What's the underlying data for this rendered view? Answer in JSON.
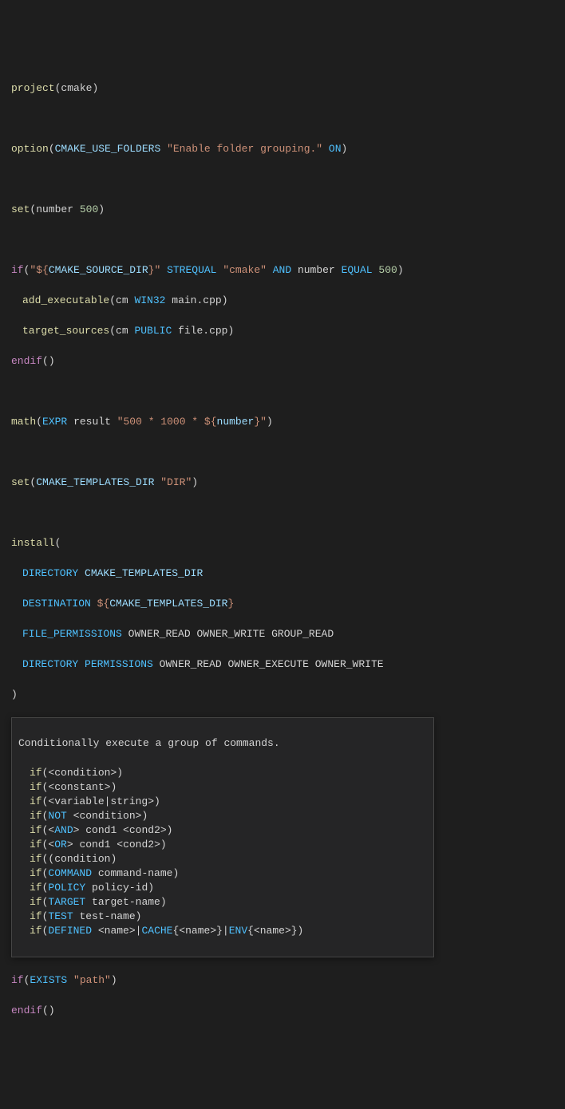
{
  "code": {
    "l1": {
      "fn": "project",
      "arg": "cmake"
    },
    "l2": {
      "fn": "option",
      "var": "CMAKE_USE_FOLDERS",
      "str": "\"Enable folder grouping.\"",
      "on": "ON"
    },
    "l3": {
      "fn": "set",
      "var": "number",
      "num": "500"
    },
    "l4": {
      "fn": "if",
      "str1": "\"${",
      "var1": "CMAKE_SOURCE_DIR",
      "str1b": "}\"",
      "op1": "STREQUAL",
      "str2": "\"cmake\"",
      "op2": "AND",
      "var2": "number",
      "op3": "EQUAL",
      "num": "500"
    },
    "l5": {
      "fn": "add_executable",
      "a1": "cm",
      "a2": "WIN32",
      "a3": "main.cpp"
    },
    "l6": {
      "fn": "target_sources",
      "a1": "cm",
      "a2": "PUBLIC",
      "a3": "file.cpp"
    },
    "l7": {
      "fn": "endif"
    },
    "l8": {
      "fn": "math",
      "a1": "EXPR",
      "a2": "result",
      "s1": "\"500 * 1000 * ${",
      "v": "number",
      "s2": "}\""
    },
    "l9": {
      "fn": "set",
      "v": "CMAKE_TEMPLATES_DIR",
      "s": "\"DIR\""
    },
    "l10": {
      "fn": "install"
    },
    "l11": {
      "kw": "DIRECTORY",
      "v": "CMAKE_TEMPLATES_DIR"
    },
    "l12": {
      "kw": "DESTINATION",
      "s1": "${",
      "v": "CMAKE_TEMPLATES_DIR",
      "s2": "}"
    },
    "l13": {
      "kw": "FILE_PERMISSIONS",
      "a1": "OWNER_READ",
      "a2": "OWNER_WRITE",
      "a3": "GROUP_READ"
    },
    "l14": {
      "kw": "DIRECTORY",
      "kw2": "PERMISSIONS",
      "a1": "OWNER_READ",
      "a2": "OWNER_EXECUTE",
      "a3": "OWNER_WRITE"
    },
    "l15": {
      "close": ")"
    },
    "l16": {
      "fn": "if",
      "a1": "EXISTS",
      "s": "\"path\""
    },
    "l17": {
      "fn": "endif"
    }
  },
  "tooltip": {
    "title": "Conditionally execute a group of commands.",
    "rows": [
      {
        "fn": "if",
        "pre": "(<",
        "t": "condition",
        "post": ">)"
      },
      {
        "fn": "if",
        "pre": "(<",
        "t": "constant",
        "post": ">)"
      },
      {
        "fn": "if",
        "pre": "(<",
        "t": "variable|string",
        "post": ">)"
      },
      {
        "fn": "if",
        "pre": "(",
        "kw": "NOT",
        "mid": " <",
        "t": "condition",
        "post": ">)"
      },
      {
        "fn": "if",
        "pre": "(<",
        "t": "cond1",
        "mid": "> ",
        "kw": "AND",
        "mid2": " <",
        "t2": "cond2",
        "post": ">)"
      },
      {
        "fn": "if",
        "pre": "(<",
        "t": "cond1",
        "mid": "> ",
        "kw": "OR",
        "mid2": " <",
        "t2": "cond2",
        "post": ">)"
      },
      {
        "fn": "if",
        "pre": "((",
        "t": "condition",
        "post": ")"
      },
      {
        "fn": "if",
        "pre": "(",
        "kw": "COMMAND",
        "mid": " ",
        "t": "command-name",
        "post": ")"
      },
      {
        "fn": "if",
        "pre": "(",
        "kw": "POLICY",
        "mid": " ",
        "t": "policy-id",
        "post": ")"
      },
      {
        "fn": "if",
        "pre": "(",
        "kw": "TARGET",
        "mid": " ",
        "t": "target-name",
        "post": ")"
      },
      {
        "fn": "if",
        "pre": "(",
        "kw": "TEST",
        "mid": " ",
        "t": "test-name",
        "post": ")"
      },
      {
        "fn": "if",
        "pre": "(",
        "kw": "DEFINED",
        "mid": " <",
        "t": "name",
        "mid2": ">|",
        "kw2": "CACHE",
        "mid3": "{<",
        "t2": "name",
        "mid4": ">}|",
        "kw3": "ENV",
        "mid5": "{<",
        "t3": "name",
        "post": ">})"
      }
    ]
  }
}
